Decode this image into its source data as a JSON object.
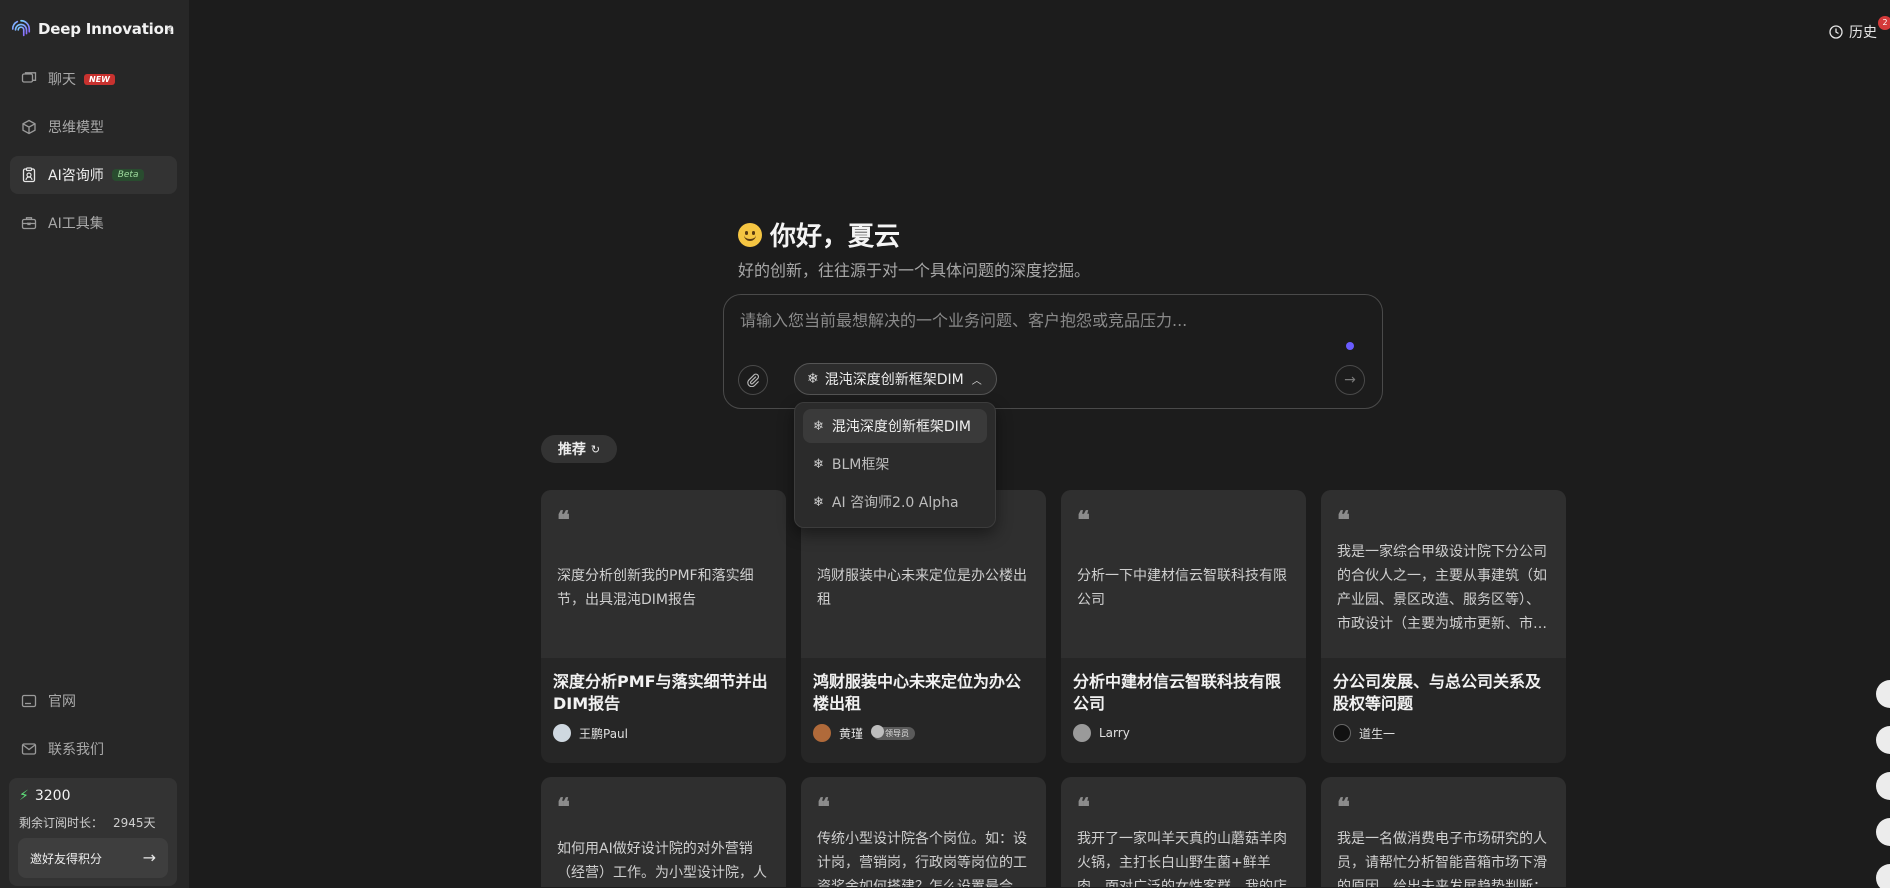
{
  "brand": {
    "name": "Deep Innovation",
    "collapse_icon": "chevron-left-icon"
  },
  "nav": {
    "items": [
      {
        "label": "聊天",
        "badge": "NEW",
        "icon": "chat-icon",
        "active": false
      },
      {
        "label": "思维模型",
        "icon": "cube-icon",
        "active": false
      },
      {
        "label": "AI咨询师",
        "badge": "Beta",
        "icon": "clipboard-icon",
        "active": true
      },
      {
        "label": "AI工具集",
        "icon": "toolbox-icon",
        "active": false
      }
    ],
    "bottom": [
      {
        "label": "官网",
        "icon": "monitor-icon"
      },
      {
        "label": "联系我们",
        "icon": "mail-icon"
      }
    ]
  },
  "credits": {
    "points": "3200",
    "sub_label": "剩余订阅时长：",
    "sub_value": "2945天",
    "invite_label": "邀好友得积分"
  },
  "header": {
    "history_label": "历史",
    "notif_count": "2"
  },
  "greeting": {
    "title": "你好，夏云",
    "subtitle": "好的创新，往往源于对一个具体问题的深度挖掘。"
  },
  "composer": {
    "placeholder": "请输入您当前最想解决的一个业务问题、客户抱怨或竞品压力...",
    "value": "",
    "model_label": "混沌深度创新框架DIM"
  },
  "dropdown": {
    "options": [
      {
        "label": "混沌深度创新框架DIM",
        "selected": true
      },
      {
        "label": "BLM框架",
        "selected": false
      },
      {
        "label": "AI 咨询师2.0 Alpha",
        "selected": false
      }
    ]
  },
  "recommend": {
    "label": "推荐"
  },
  "cards": [
    {
      "body": "深度分析创新我的PMF和落实细节，出具混沌DIM报告",
      "title": "深度分析PMF与落实细节并出DIM报告",
      "author": "王鹏Paul"
    },
    {
      "body": "鸿财服装中心未来定位是办公楼出租",
      "title": "鸿财服装中心未来定位为办公楼出租",
      "author": "黄瑾",
      "author_badge": "领导员"
    },
    {
      "body": "分析一下中建材信云智联科技有限公司",
      "title": "分析中建材信云智联科技有限公司",
      "author": "Larry"
    },
    {
      "body": "我是一家综合甲级设计院下分公司的合伙人之一，主要从事建筑（如产业园、景区改造、服务区等）、市政设计（主要为城市更新、市…",
      "title": "分公司发展、与总公司关系及股权等问题",
      "author": "道生一"
    }
  ],
  "cards_row2": [
    {
      "body": "如何用AI做好设计院的对外营销（经营）工作。为小型设计院，人"
    },
    {
      "body": "传统小型设计院各个岗位。如：设计岗，营销岗，行政岗等岗位的工资奖金如何搭建？怎么设置最合"
    },
    {
      "body": "我开了一家叫羊天真的山蘑菇羊肉火锅，主打长白山野生菌+鲜羊肉，面对广泛的女性客群，我的店"
    },
    {
      "body": "我是一名做消费电子市场研究的人员，请帮忙分析智能音箱市场下滑的原因，给出未来发展趋势判断；"
    }
  ]
}
